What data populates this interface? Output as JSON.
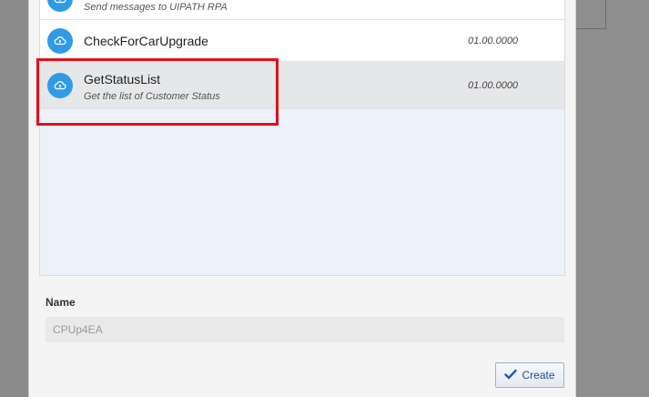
{
  "integrations_list": {
    "items": [
      {
        "title": "",
        "description": "Send messages to UIPATH RPA",
        "version": "",
        "icon": "cloud-sync-icon"
      },
      {
        "title": "CheckForCarUpgrade",
        "description": "",
        "version": "01.00.0000",
        "icon": "cloud-sync-icon"
      },
      {
        "title": "GetStatusList",
        "description": "Get the list of Customer Status",
        "version": "01.00.0000",
        "icon": "cloud-sync-icon",
        "selected": true
      }
    ]
  },
  "form": {
    "name_label": "Name",
    "name_value": "CPUp4EA"
  },
  "actions": {
    "create_label": "Create",
    "create_icon": "checkmark-icon"
  },
  "colors": {
    "icon_blue": "#2f9be4",
    "highlight_red": "#e0101a",
    "selected_row": "#e6e7e9"
  }
}
